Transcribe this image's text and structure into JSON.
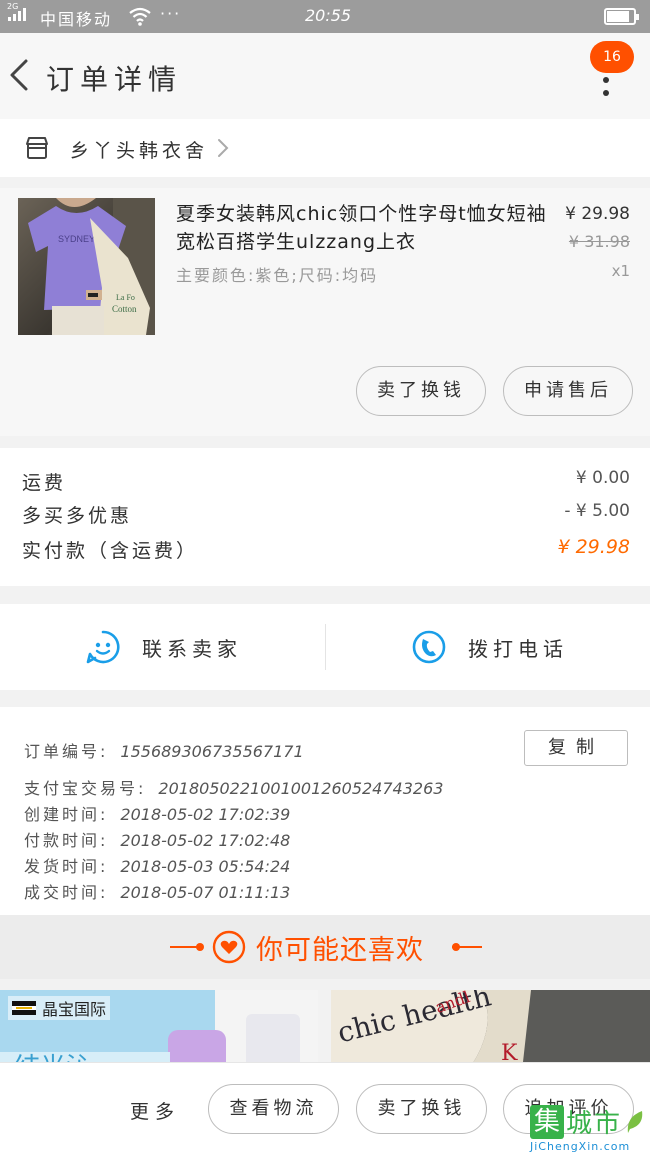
{
  "status_bar": {
    "network": "2G",
    "carrier": "中国移动",
    "more": "···",
    "time": "20:55",
    "battery_level": 0.85
  },
  "header": {
    "title": "订单详情",
    "badge_count": "16"
  },
  "shop": {
    "name": "乡丫头韩衣舍"
  },
  "product": {
    "image_text": "Cotton",
    "title": "夏季女装韩风chic领口个性字母t恤女短袖宽松百搭学生ulzzang上衣",
    "spec": "主要颜色:紫色;尺码:均码",
    "price_now": "¥ 29.98",
    "price_old": "¥ 31.98",
    "quantity": "x1",
    "buttons": [
      "卖了换钱",
      "申请售后"
    ]
  },
  "costs": [
    {
      "label": "运费",
      "value": "¥ 0.00"
    },
    {
      "label": "多买多优惠",
      "value": "- ¥ 5.00"
    },
    {
      "label": "实付款（含运费）",
      "value": "¥ 29.98"
    }
  ],
  "contact": {
    "seller_label": "联系卖家",
    "call_label": "拨打电话"
  },
  "order_info": {
    "copy_label": "复制",
    "lines": [
      {
        "key": "订单编号:",
        "value": "155689306735567171"
      },
      {
        "key": "支付宝交易号:",
        "value": "2018050221001001260524743263"
      },
      {
        "key": "创建时间:",
        "value": "2018-05-02 17:02:39"
      },
      {
        "key": "付款时间:",
        "value": "2018-05-02 17:02:48"
      },
      {
        "key": "发货时间:",
        "value": "2018-05-03 05:54:24"
      },
      {
        "key": "成交时间:",
        "value": "2018-05-07 01:11:13"
      }
    ]
  },
  "recommend": {
    "title": "你可能还喜欢",
    "card1_brand": "晶宝国际",
    "card1_text": "结光沁",
    "card2_text": "chic health"
  },
  "bottom_bar": {
    "more": "更多",
    "buttons": [
      "查看物流",
      "卖了换钱",
      "追加评价"
    ]
  },
  "watermark": {
    "mark": "集",
    "title": "城市",
    "url": "JiChengXin.com"
  },
  "colors": {
    "accent": "#ff5000",
    "price": "#ff6a00",
    "icon_blue": "#1a9ee8"
  }
}
